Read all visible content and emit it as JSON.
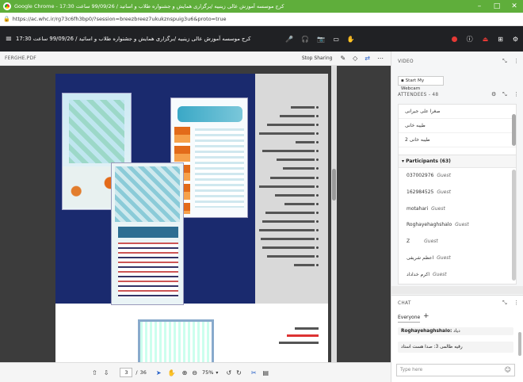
{
  "browser": {
    "window_title": "Google Chrome - 17:30 کرج موسسه آموزش عالی زینبیه /برگزاری همایش و جشنواره طلاب و اساتید / 99/09/26 ساعت",
    "url": "https://ac.whc.ir/rg73c6fh3bp0/?session=breezbreez7ukukznspuig3u6&proto=true",
    "minimize": "–",
    "maximize": "□",
    "close": "✕"
  },
  "meeting": {
    "title": "17:30 کرج موسسه آموزش عالی زینبیه /برگزاری همایش و جشنواره طلاب و اساتید / 99/09/26 ساعت"
  },
  "presentation": {
    "file_name": "FERGHE.PDF",
    "stop_sharing": "Stop Sharing",
    "page_current": "3",
    "page_separator": "/",
    "page_total": "36",
    "zoom": "75%"
  },
  "panel": {
    "video_title": "VIDEO",
    "webcam_button": "Start My Webcam",
    "attendees_title": "ATTENDEES",
    "attendees_count": "48",
    "attendees": [
      "صغرا علی جیرانی",
      "طیبه خانی",
      "طیبه خانی 2"
    ],
    "participants_header": "Participants (63)",
    "participants": [
      {
        "name": "037002976",
        "role": "Guest"
      },
      {
        "name": "162984525",
        "role": "Guest"
      },
      {
        "name": "motahari",
        "role": "Guest"
      },
      {
        "name": "Roghayehaghshalo",
        "role": "Guest"
      },
      {
        "name": "Z",
        "role": "Guest"
      },
      {
        "name": "اعظم شریفی",
        "role": "Guest"
      },
      {
        "name": "اکرم خداداد",
        "role": "Guest"
      }
    ],
    "chat_title": "CHAT",
    "chat_tab": "Everyone",
    "chat_messages": [
      {
        "user": "Roghayehaghshalo:",
        "text": "دیاد"
      },
      {
        "user": "",
        "text": "رقیه ظالمی 3: صدا هست استاد"
      }
    ],
    "chat_placeholder": "Type here"
  }
}
